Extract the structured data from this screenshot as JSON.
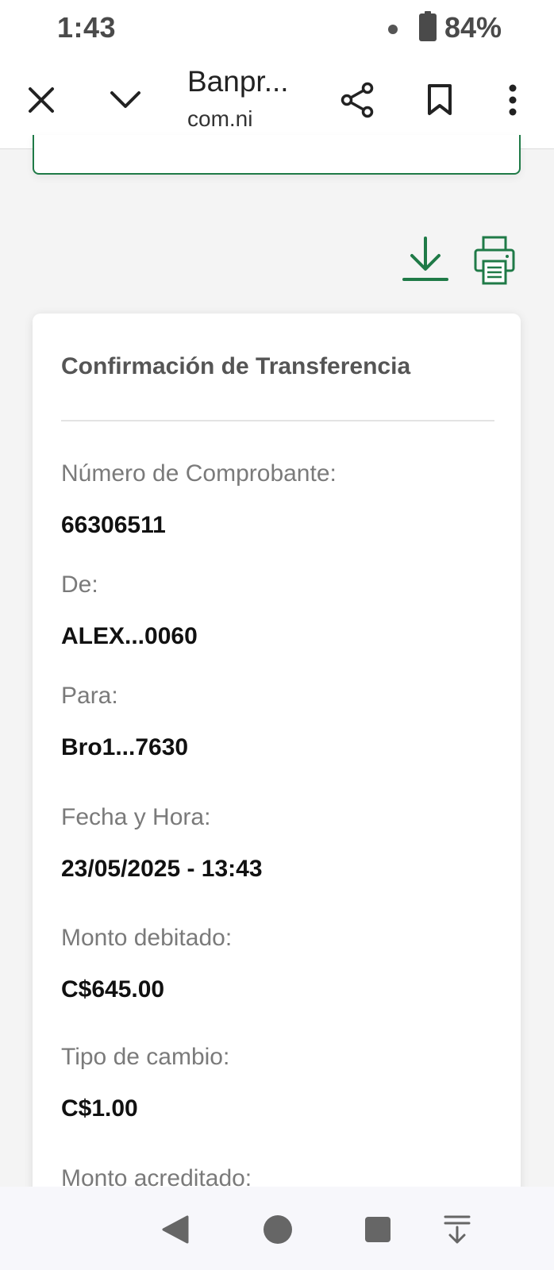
{
  "status_bar": {
    "time": "1:43",
    "battery": "84%"
  },
  "toolbar": {
    "title": "Banpr...",
    "domain": "com.ni"
  },
  "receipt": {
    "title": "Confirmación de Transferencia",
    "fields": [
      {
        "label": "Número de Comprobante:",
        "value": "66306511"
      },
      {
        "label": "De:",
        "value": "ALEX...0060"
      },
      {
        "label": "Para:",
        "value": "Bro1...7630"
      },
      {
        "label": "Fecha y Hora:",
        "value": "23/05/2025 - 13:43"
      },
      {
        "label": "Monto debitado:",
        "value": "C$645.00"
      },
      {
        "label": "Tipo de cambio:",
        "value": "C$1.00"
      },
      {
        "label": "Monto acreditado:",
        "value": ""
      }
    ]
  },
  "colors": {
    "accent": "#1f7a47",
    "card_bg": "#ffffff",
    "page_bg": "#f4f4f4"
  },
  "icons": [
    "close-icon",
    "chevron-down-icon",
    "share-icon",
    "bookmark-icon",
    "more-vertical-icon",
    "download-icon",
    "print-icon",
    "back-icon",
    "home-icon",
    "recents-icon",
    "nav-collapse-icon"
  ]
}
